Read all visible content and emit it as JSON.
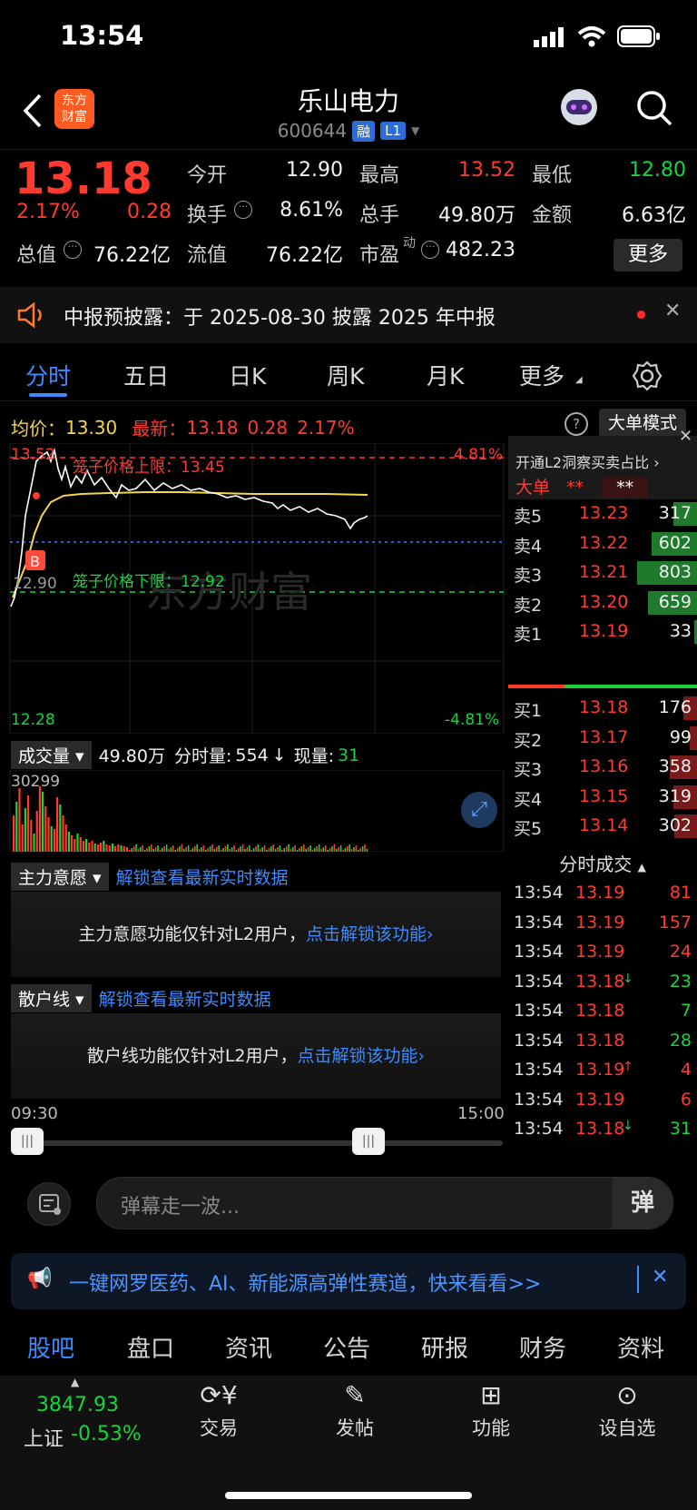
{
  "status": {
    "time": "13:54"
  },
  "header": {
    "name": "乐山电力",
    "code": "600644",
    "tag_rong": "融",
    "tag_l1": "L1",
    "logo_line1": "东方",
    "logo_line2": "财富"
  },
  "quote": {
    "price": "13.18",
    "change_pct": "2.17%",
    "change": "0.28",
    "open_label": "今开",
    "open": "12.90",
    "high_label": "最高",
    "high": "13.52",
    "low_label": "最低",
    "low": "12.80",
    "turnover_label": "换手",
    "turnover": "8.61%",
    "volume_label": "总手",
    "volume": "49.80万",
    "amount_label": "金额",
    "amount": "6.63亿",
    "mktcap_label": "总值",
    "mktcap": "76.22亿",
    "float_label": "流值",
    "float": "76.22亿",
    "pe_label": "市盈",
    "pe_sup": "动",
    "pe": "482.23",
    "more_button": "更多"
  },
  "notice": {
    "text": "中报预披露：于 2025-08-30 披露 2025 年中报"
  },
  "tabs": {
    "t1": "分时",
    "t2": "五日",
    "t3": "日K",
    "t4": "周K",
    "t5": "月K",
    "t6": "更多"
  },
  "chart": {
    "avg_label": "均价：",
    "avg": "13.30",
    "last_label": "最新：",
    "last": "13.18",
    "last_change": "0.28",
    "last_pct": "2.17%",
    "big_order_button": "大单模式",
    "y_top": "13.52",
    "y_top_pct": "4.81%",
    "y_bottom": "12.28",
    "y_bottom_pct": "-4.81%",
    "y_mid": "12.90",
    "upper_limit_label": "笼子价格上限：13.45",
    "lower_limit_label": "笼子价格下限：12.92",
    "watermark": "东方财富",
    "b_marker": "B"
  },
  "volume": {
    "selector": "成交量",
    "total": "49.80万",
    "minute_label": "分时量:",
    "minute": "554",
    "now_label": "现量:",
    "now": "31",
    "max": "30299"
  },
  "main_force": {
    "selector": "主力意愿",
    "unlock_link": "解锁查看最新实时数据",
    "box_text": "主力意愿功能仅针对L2用户，",
    "box_link": "点击解锁该功能"
  },
  "retail": {
    "selector": "散户线",
    "unlock_link": "解锁查看最新实时数据",
    "box_text": "散户线功能仅针对L2用户，",
    "box_link": "点击解锁该功能"
  },
  "time_axis": {
    "start": "09:30",
    "end": "15:00"
  },
  "right_panel": {
    "l2_promo": "开通L2洞察买卖占比",
    "big_order_label": "大单",
    "big_order_val1": "**",
    "big_order_val2": "**",
    "asks": [
      {
        "label": "卖5",
        "price": "13.23",
        "vol": "317",
        "bar": 0.4
      },
      {
        "label": "卖4",
        "price": "13.22",
        "vol": "602",
        "bar": 0.75
      },
      {
        "label": "卖3",
        "price": "13.21",
        "vol": "803",
        "bar": 1.0
      },
      {
        "label": "卖2",
        "price": "13.20",
        "vol": "659",
        "bar": 0.82
      },
      {
        "label": "卖1",
        "price": "13.19",
        "vol": "33",
        "bar": 0.04
      }
    ],
    "bids": [
      {
        "label": "买1",
        "price": "13.18",
        "vol": "176",
        "bar": 0.22
      },
      {
        "label": "买2",
        "price": "13.17",
        "vol": "99",
        "bar": 0.12
      },
      {
        "label": "买3",
        "price": "13.16",
        "vol": "358",
        "bar": 0.45
      },
      {
        "label": "买4",
        "price": "13.15",
        "vol": "319",
        "bar": 0.4
      },
      {
        "label": "买5",
        "price": "13.14",
        "vol": "302",
        "bar": 0.38
      }
    ],
    "trades_title": "分时成交",
    "trades": [
      {
        "time": "13:54",
        "price": "13.19",
        "arrow": "",
        "vol": "81",
        "dir": "up"
      },
      {
        "time": "13:54",
        "price": "13.19",
        "arrow": "",
        "vol": "157",
        "dir": "up"
      },
      {
        "time": "13:54",
        "price": "13.19",
        "arrow": "",
        "vol": "24",
        "dir": "up"
      },
      {
        "time": "13:54",
        "price": "13.18",
        "arrow": "↓",
        "vol": "23",
        "dir": "down"
      },
      {
        "time": "13:54",
        "price": "13.18",
        "arrow": "",
        "vol": "7",
        "dir": "down"
      },
      {
        "time": "13:54",
        "price": "13.18",
        "arrow": "",
        "vol": "28",
        "dir": "down"
      },
      {
        "time": "13:54",
        "price": "13.19",
        "arrow": "↑",
        "vol": "4",
        "dir": "up"
      },
      {
        "time": "13:54",
        "price": "13.19",
        "arrow": "",
        "vol": "6",
        "dir": "up"
      },
      {
        "time": "13:54",
        "price": "13.18",
        "arrow": "↓",
        "vol": "31",
        "dir": "down"
      }
    ]
  },
  "danmu": {
    "placeholder": "弹幕走一波..."
  },
  "promo": {
    "text": "一键网罗医药、AI、新能源高弹性赛道，快来看看>>"
  },
  "bottom_tabs": {
    "b1": "股吧",
    "b2": "盘口",
    "b3": "资讯",
    "b4": "公告",
    "b5": "研报",
    "b6": "财务",
    "b7": "资料"
  },
  "nav": {
    "index_value": "3847.93",
    "index_name": "上证",
    "index_change": "-0.53%",
    "trade": "交易",
    "post": "发帖",
    "function": "功能",
    "watchlist": "设自选"
  },
  "colors": {
    "up": "#ff3b30",
    "down": "#19d43a",
    "accent": "#3d8bff",
    "avg_line": "#f5d54a"
  }
}
